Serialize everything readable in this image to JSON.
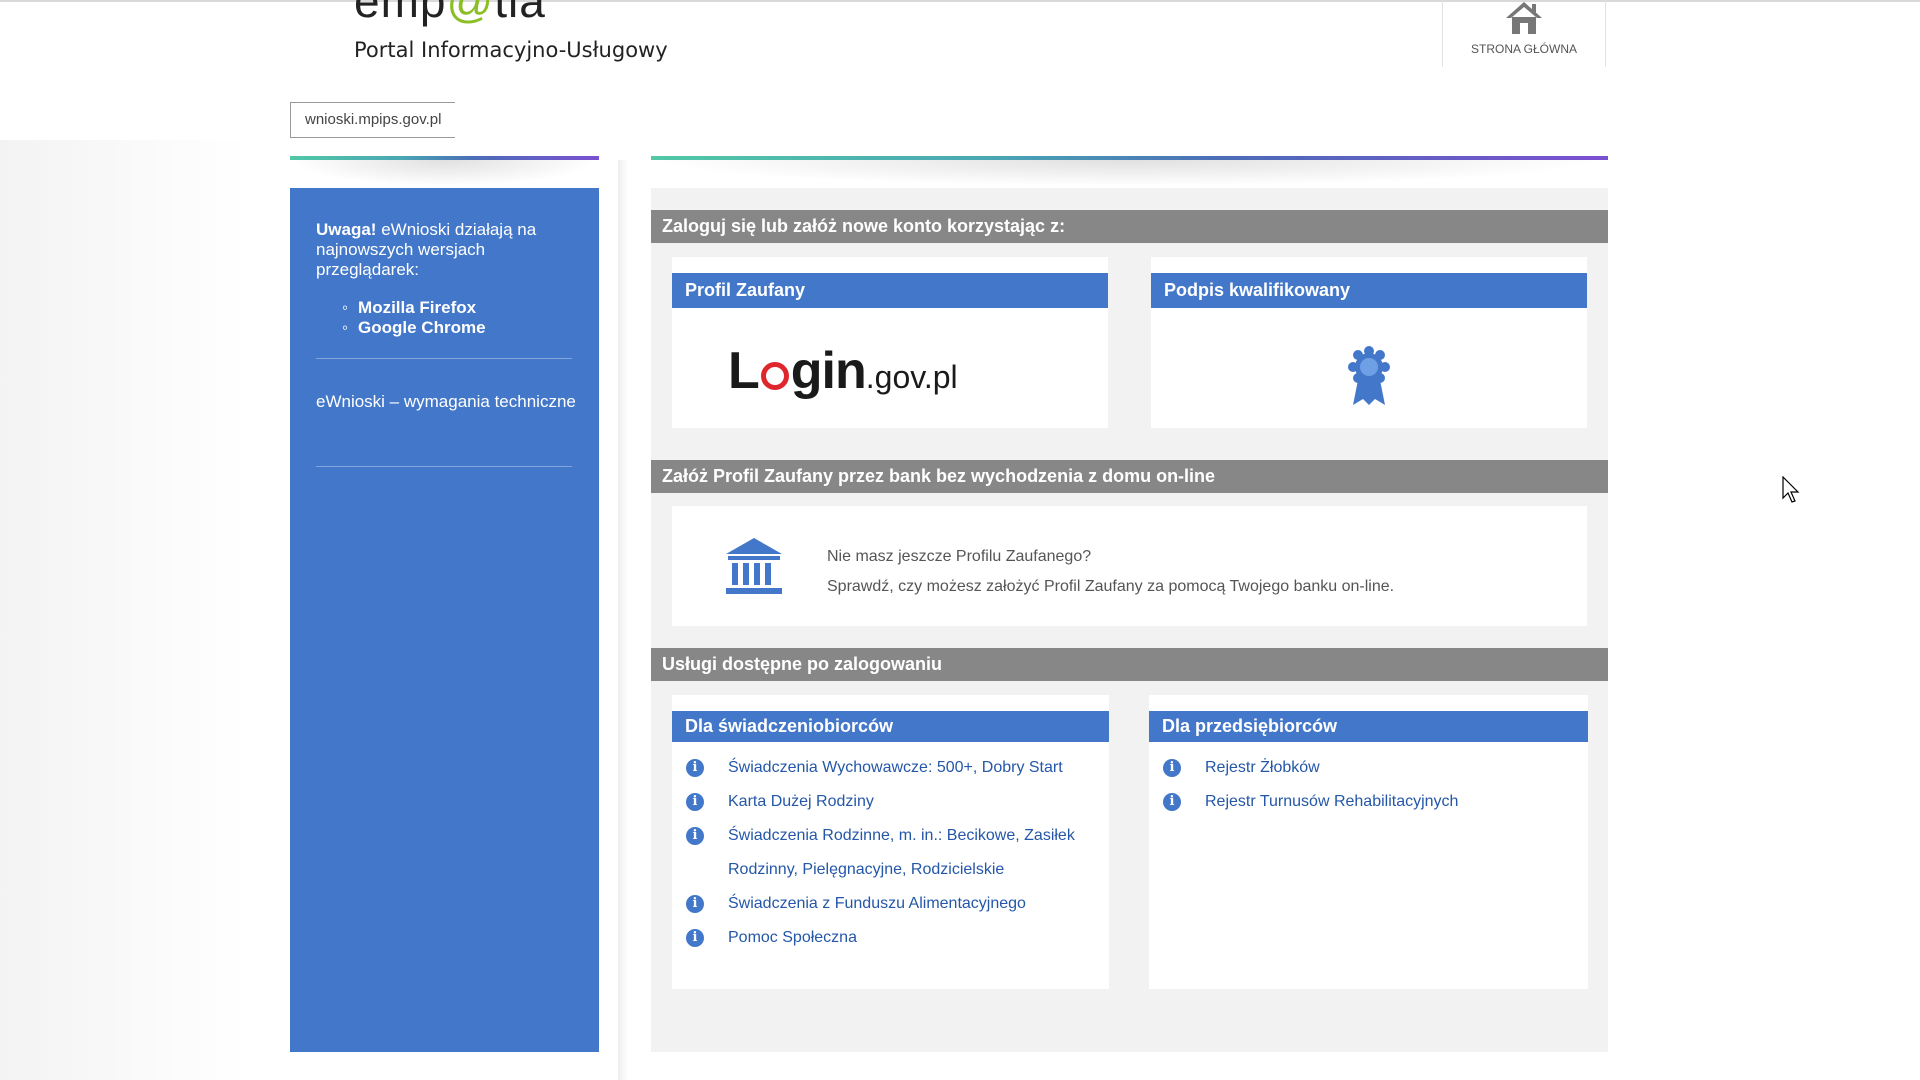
{
  "header": {
    "logo_text_pre": "emp",
    "logo_text_at": "@",
    "logo_text_post": "tia",
    "subtitle": "Portal Informacyjno-Usługowy",
    "home_label": "STRONA GŁÓWNA"
  },
  "breadcrumb": {
    "label": "wnioski.mpips.gov.pl"
  },
  "sidebar": {
    "note_bold": "Uwaga!",
    "note_text": " eWnioski działają na najnowszych wersjach przeglądarek:",
    "browsers": [
      "Mozilla Firefox",
      "Google Chrome"
    ],
    "link": "eWnioski – wymagania techniczne"
  },
  "login_section": {
    "title": "Zaloguj się lub załóż nowe konto korzystając z:",
    "profil_title": "Profil Zaufany",
    "login_logo": {
      "pre": "L",
      "post": "gin",
      "suffix": ".gov.pl"
    },
    "podpis_title": "Podpis kwalifikowany"
  },
  "bank_section": {
    "title": "Załóż Profil Zaufany przez bank bez wychodzenia z domu on-line",
    "line1": "Nie masz jeszcze Profilu Zaufanego?",
    "line2": "Sprawdź, czy możesz założyć Profil Zaufany za pomocą Twojego banku on-line."
  },
  "services_section": {
    "title": "Usługi dostępne po zalogowaniu",
    "beneficiaries": {
      "title": "Dla świadczeniobiorców",
      "items": [
        "Świadczenia Wychowawcze: 500+, Dobry Start",
        "Karta Dużej Rodziny",
        "Świadczenia Rodzinne, m. in.: Becikowe, Zasiłek Rodzinny, Pielęgnacyjne, Rodzicielskie",
        "Świadczenia z Funduszu Alimentacyjnego",
        "Pomoc Społeczna"
      ]
    },
    "entrepreneurs": {
      "title": "Dla przedsiębiorców",
      "items": [
        "Rejestr Żłobków",
        "Rejestr Turnusów Rehabilitacyjnych"
      ]
    }
  },
  "colors": {
    "brand_blue": "#4377c9",
    "section_grey": "#878787",
    "logo_green": "#8cbf26",
    "link_blue": "#2457a8"
  },
  "icons": {
    "home": "home-icon",
    "bank": "bank-icon",
    "rosette": "award-rosette-icon",
    "info": "info-icon"
  }
}
